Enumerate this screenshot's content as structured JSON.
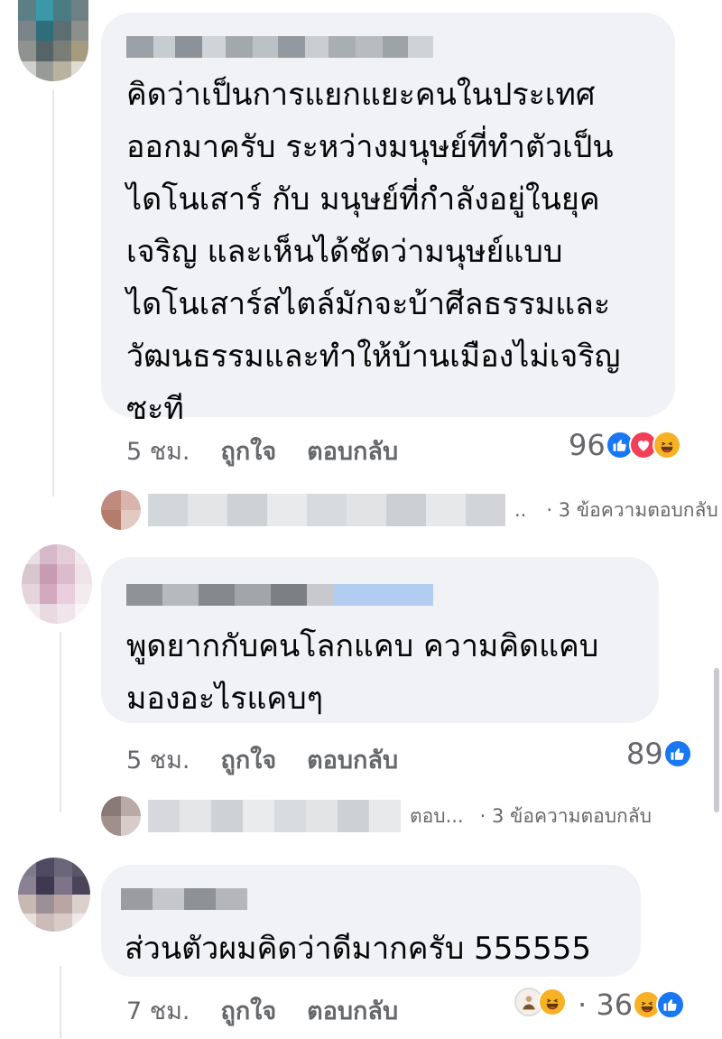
{
  "comments": [
    {
      "text": "คิดว่าเป็นการแยกแยะคนในประเทศ\nออกมาครับ  ระหว่างมนุษย์ที่ทำตัวเป็น\nไดโนเสาร์ กับ มนุษย์ที่กำลังอยู่ในยุค\nเจริญ  และเห็นได้ชัดว่ามนุษย์แบบ\nไดโนเสาร์สไตล์มักจะบ้าศีลธรรมและ\nวัฒนธรรมและทำให้บ้านเมืองไม่เจริญ\nซะที",
      "time": "5 ชม.",
      "like_label": "ถูกใจ",
      "reply_label": "ตอบกลับ",
      "reaction_count": "96",
      "reactions": [
        "like-icon",
        "love-icon",
        "haha-icon"
      ],
      "reply_preview": "..",
      "reply_count": "· 3 ข้อความตอบกลับ"
    },
    {
      "text": "พูดยากกับคนโลกแคบ ความคิดแคบ\nมองอะไรแคบๆ",
      "time": "5 ชม.",
      "like_label": "ถูกใจ",
      "reply_label": "ตอบกลับ",
      "reaction_count": "89",
      "reactions": [
        "like-icon"
      ],
      "reply_preview": "ตอบ...",
      "reply_count": "· 3 ข้อความตอบกลับ"
    },
    {
      "text": "ส่วนตัวผมคิดว่าดีมากครับ 555555",
      "time": "7 ชม.",
      "like_label": "ถูกใจ",
      "reply_label": "ตอบกลับ",
      "reaction_count": "· 36",
      "reactions": [
        "haha-icon",
        "like-icon"
      ]
    }
  ],
  "colors": {
    "bubble": "#f0f2f5",
    "meta_text": "#65676b",
    "like": "#1877f2",
    "love": "#f33e58",
    "haha": "#f7b125"
  }
}
